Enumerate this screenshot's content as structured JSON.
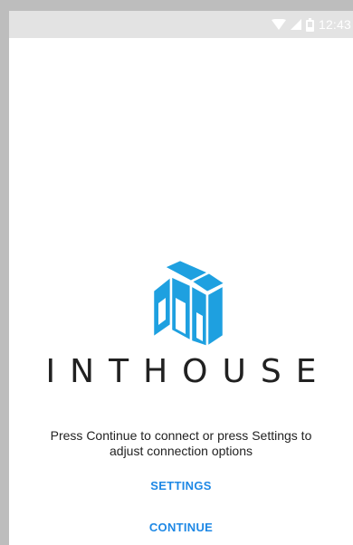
{
  "status_bar": {
    "time": "12:43",
    "icons": [
      "wifi-icon",
      "cell-signal-icon",
      "battery-icon"
    ]
  },
  "brand": {
    "name": "INTHOUSE",
    "logo_icon": "house-logo-icon",
    "logo_color": "#1ea0e0"
  },
  "main": {
    "message": "Press Continue to connect or press Settings to adjust connection options",
    "settings_label": "SETTINGS",
    "continue_label": "CONTINUE",
    "accent_color": "#1e88e5"
  }
}
